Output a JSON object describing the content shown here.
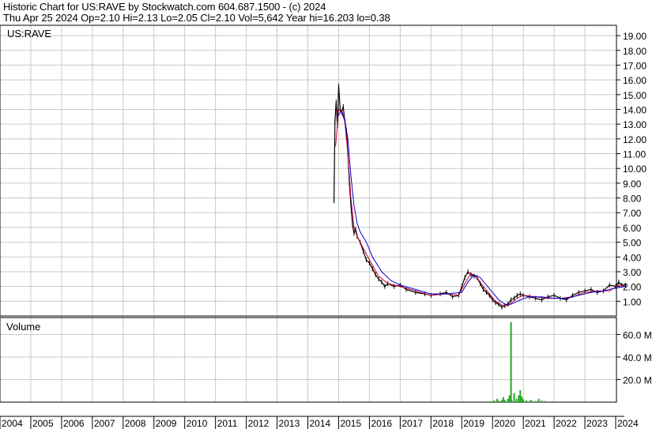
{
  "header": {
    "line1": "Historic Chart for US:RAVE by Stockwatch.com 604.687.1500 - (c) 2024",
    "line2": "Thu Apr 25 2024   Op=2.10   Hi=2.13   Lo=2.05   Cl=2.10   Vol=5,642   Year hi=16.203   lo=0.38"
  },
  "chart_data": [
    {
      "type": "line",
      "title": "US:RAVE",
      "y_ticks": [
        "1.00",
        "2.00",
        "3.00",
        "4.00",
        "5.00",
        "6.00",
        "7.00",
        "8.00",
        "9.00",
        "10.00",
        "11.00",
        "12.00",
        "13.00",
        "14.00",
        "15.00",
        "16.00",
        "17.00",
        "18.00",
        "19.00"
      ],
      "ylim": [
        0,
        19.7
      ],
      "x_ticks": [
        "2004",
        "2005",
        "2006",
        "2007",
        "2008",
        "2009",
        "2010",
        "2011",
        "2012",
        "2013",
        "2014",
        "2015",
        "2016",
        "2017",
        "2018",
        "2019",
        "2020",
        "2021",
        "2022",
        "2023",
        "2024"
      ],
      "grid": true,
      "series": [
        {
          "role": "price",
          "color": "#000000",
          "x": [
            2014.85,
            2014.88,
            2014.92,
            2014.96,
            2015.0,
            2015.05,
            2015.1,
            2015.15,
            2015.2,
            2015.25,
            2015.3,
            2015.35,
            2015.4,
            2015.45,
            2015.5,
            2015.55,
            2015.6,
            2015.7,
            2015.8,
            2015.9,
            2016.0,
            2016.1,
            2016.2,
            2016.3,
            2016.4,
            2016.5,
            2016.6,
            2016.8,
            2017.0,
            2017.2,
            2017.5,
            2017.8,
            2018.0,
            2018.3,
            2018.5,
            2018.7,
            2018.9,
            2019.0,
            2019.1,
            2019.2,
            2019.3,
            2019.4,
            2019.5,
            2019.6,
            2019.7,
            2019.8,
            2019.9,
            2020.0,
            2020.1,
            2020.2,
            2020.3,
            2020.4,
            2020.5,
            2020.6,
            2020.7,
            2020.8,
            2020.9,
            2021.0,
            2021.2,
            2021.4,
            2021.6,
            2021.8,
            2022.0,
            2022.2,
            2022.4,
            2022.6,
            2022.8,
            2023.0,
            2023.2,
            2023.4,
            2023.6,
            2023.8,
            2024.0,
            2024.1,
            2024.2,
            2024.32
          ],
          "y": [
            7.8,
            13.2,
            14.5,
            12.9,
            15.6,
            14.0,
            13.8,
            14.2,
            13.2,
            12.6,
            11.0,
            9.0,
            7.5,
            6.2,
            5.6,
            5.9,
            5.4,
            5.0,
            4.4,
            3.8,
            3.6,
            3.2,
            2.8,
            2.5,
            2.3,
            2.0,
            2.2,
            2.0,
            2.1,
            1.8,
            1.6,
            1.5,
            1.4,
            1.5,
            1.6,
            1.3,
            1.4,
            2.0,
            2.6,
            3.0,
            2.8,
            2.7,
            2.6,
            2.2,
            1.8,
            1.6,
            1.4,
            1.1,
            0.9,
            0.8,
            0.6,
            0.7,
            0.8,
            1.1,
            1.2,
            1.4,
            1.5,
            1.4,
            1.3,
            1.2,
            1.1,
            1.3,
            1.4,
            1.2,
            1.1,
            1.4,
            1.6,
            1.7,
            1.8,
            1.6,
            1.7,
            2.1,
            2.0,
            2.3,
            2.1,
            2.1
          ]
        },
        {
          "role": "moving-average-short",
          "color": "#cc0033",
          "x": [
            2014.9,
            2015.0,
            2015.1,
            2015.2,
            2015.3,
            2015.4,
            2015.5,
            2015.6,
            2015.8,
            2016.0,
            2016.3,
            2016.6,
            2017.0,
            2017.5,
            2018.0,
            2018.5,
            2018.9,
            2019.1,
            2019.3,
            2019.5,
            2019.7,
            2019.9,
            2020.1,
            2020.3,
            2020.5,
            2020.8,
            2021.0,
            2021.4,
            2021.8,
            2022.2,
            2022.6,
            2023.0,
            2023.4,
            2023.8,
            2024.1,
            2024.32
          ],
          "y": [
            11.5,
            14.0,
            13.8,
            13.2,
            11.0,
            8.0,
            6.0,
            5.4,
            4.6,
            3.8,
            2.7,
            2.2,
            2.0,
            1.7,
            1.4,
            1.5,
            1.4,
            2.2,
            2.9,
            2.6,
            2.0,
            1.5,
            1.0,
            0.75,
            0.7,
            1.2,
            1.4,
            1.3,
            1.2,
            1.2,
            1.3,
            1.6,
            1.7,
            1.7,
            2.1,
            2.0
          ]
        },
        {
          "role": "moving-average-long",
          "color": "#0000cc",
          "x": [
            2014.95,
            2015.1,
            2015.2,
            2015.3,
            2015.4,
            2015.5,
            2015.6,
            2015.7,
            2015.9,
            2016.1,
            2016.4,
            2016.7,
            2017.0,
            2017.5,
            2018.0,
            2018.5,
            2019.0,
            2019.2,
            2019.4,
            2019.6,
            2019.8,
            2020.0,
            2020.2,
            2020.4,
            2020.6,
            2020.9,
            2021.2,
            2021.6,
            2022.0,
            2022.4,
            2022.8,
            2023.2,
            2023.6,
            2024.0,
            2024.32
          ],
          "y": [
            13.5,
            13.9,
            13.3,
            12.0,
            9.5,
            7.5,
            6.3,
            5.7,
            5.0,
            4.0,
            3.0,
            2.4,
            2.1,
            1.8,
            1.5,
            1.5,
            1.6,
            2.3,
            2.8,
            2.6,
            2.1,
            1.6,
            1.1,
            0.8,
            0.8,
            1.1,
            1.3,
            1.3,
            1.2,
            1.2,
            1.4,
            1.6,
            1.7,
            1.9,
            2.0
          ]
        }
      ]
    },
    {
      "type": "bar",
      "title": "Volume",
      "y_ticks": [
        "20.0 M",
        "40.0 M",
        "60.0 M"
      ],
      "ylim": [
        0,
        75
      ],
      "grid": true,
      "bars": {
        "color": "#22aa22",
        "x": [
          2019.95,
          2020.05,
          2020.15,
          2020.2,
          2020.3,
          2020.35,
          2020.4,
          2020.5,
          2020.55,
          2020.6,
          2020.62,
          2020.7,
          2020.78,
          2020.85,
          2020.9,
          2020.95,
          2021.0,
          2021.1,
          2021.25,
          2021.4,
          2021.5,
          2021.6,
          2021.7
        ],
        "y": [
          0.8,
          1.5,
          3.0,
          1.2,
          2.0,
          4.5,
          2.0,
          3.0,
          6.0,
          71.0,
          2.0,
          8.0,
          3.0,
          6.0,
          10.5,
          5.0,
          2.5,
          1.5,
          2.0,
          1.0,
          3.0,
          1.5,
          1.0
        ]
      }
    }
  ]
}
